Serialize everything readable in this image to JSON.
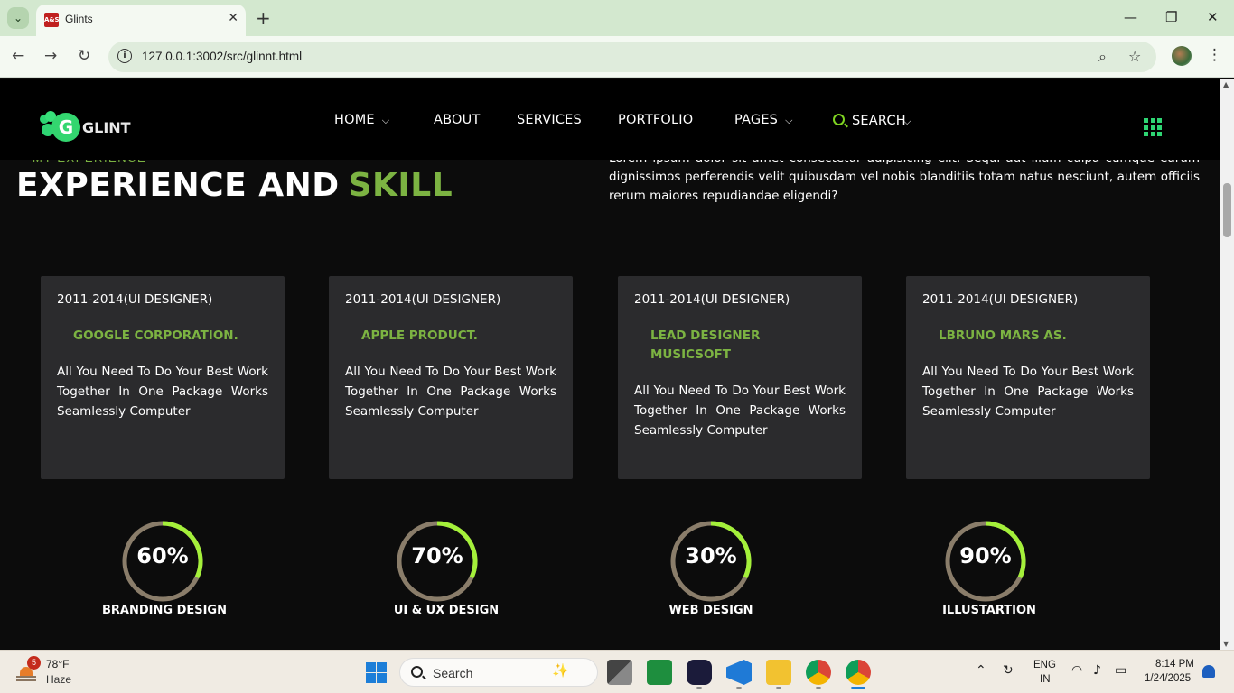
{
  "browser": {
    "tab_title": "Glints",
    "url": "127.0.0.1:3002/src/glinnt.html"
  },
  "site": {
    "logo_text": "GLINT",
    "logo_letter": "G",
    "nav": [
      {
        "label": "HOME",
        "has_caret": true
      },
      {
        "label": "ABOUT",
        "has_caret": false
      },
      {
        "label": "SERVICES",
        "has_caret": false
      },
      {
        "label": "PORTFOLIO",
        "has_caret": false
      },
      {
        "label": "PAGES",
        "has_caret": true
      },
      {
        "label": "SEARCH",
        "has_caret": true
      }
    ],
    "accent_color": "#7cb342"
  },
  "section": {
    "eyebrow": "MY EXPERIENCE",
    "heading_main": "EXPERIENCE AND",
    "heading_accent": "SKILL",
    "intro": "Lorem ipsum dolor sit amet consectetur adipisicing elit. Sequi aut illum culpa cumque earum dignissimos perferendis velit quibusdam vel nobis blanditiis totam natus nesciunt, autem officiis rerum maiores repudiandae eligendi?"
  },
  "cards": [
    {
      "years": "2011-2014(UI DESIGNER)",
      "company": "GOOGLE CORPORATION.",
      "desc": "All You Need To Do Your Best Work Together In One Package Works Seamlessly Computer"
    },
    {
      "years": "2011-2014(UI DESIGNER)",
      "company": "APPLE PRODUCT.",
      "desc": "All You Need To Do Your Best Work Together In One Package Works Seamlessly Computer"
    },
    {
      "years": "2011-2014(UI DESIGNER)",
      "company": "LEAD DESIGNER MUSICSOFT",
      "desc": "All You Need To Do Your Best Work Together In One Package Works Seamlessly Computer"
    },
    {
      "years": "2011-2014(UI DESIGNER)",
      "company": "LBRUNO MARS AS.",
      "desc": "All You Need To Do Your Best Work Together In One Package Works Seamlessly Computer"
    }
  ],
  "skills": [
    {
      "percent": "60%",
      "label": "BRANDING DESIGN"
    },
    {
      "percent": "70%",
      "label": "UI & UX DESIGN"
    },
    {
      "percent": "30%",
      "label": "WEB DESIGN"
    },
    {
      "percent": "90%",
      "label": "ILLUSTARTION"
    }
  ],
  "taskbar": {
    "weather_badge": "5",
    "temperature": "78°F",
    "condition": "Haze",
    "search_placeholder": "Search",
    "lang_top": "ENG",
    "lang_bottom": "IN",
    "time": "8:14 PM",
    "date": "1/24/2025"
  }
}
